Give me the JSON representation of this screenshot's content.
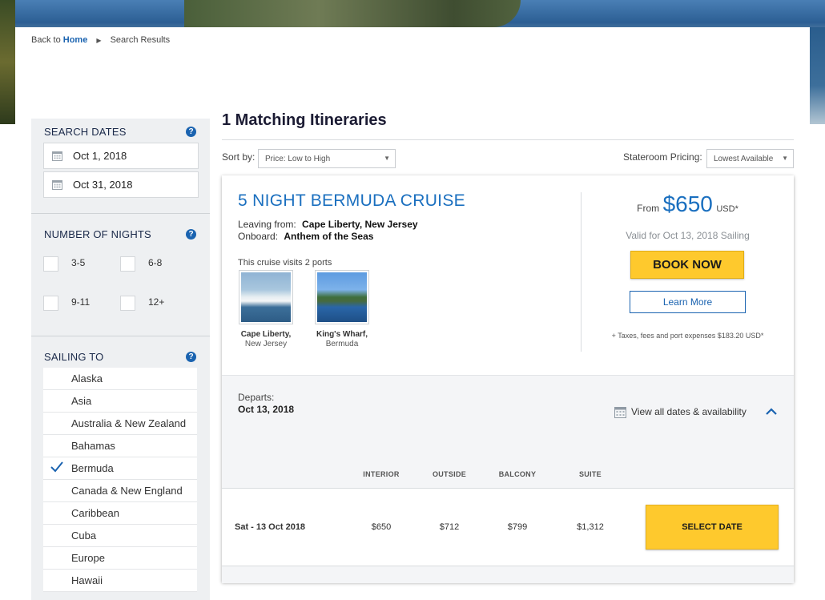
{
  "breadcrumb": {
    "back_prefix": "Back to",
    "home": "Home",
    "current": "Search Results"
  },
  "sidebar": {
    "search_dates": {
      "title": "SEARCH DATES",
      "start": "Oct 1, 2018",
      "end": "Oct 31, 2018"
    },
    "nights": {
      "title": "NUMBER OF NIGHTS",
      "options": [
        "3-5",
        "6-8",
        "9-11",
        "12+"
      ]
    },
    "sailing_to": {
      "title": "SAILING TO",
      "items": [
        "Alaska",
        "Asia",
        "Australia & New Zealand",
        "Bahamas",
        "Bermuda",
        "Canada & New England",
        "Caribbean",
        "Cuba",
        "Europe",
        "Hawaii"
      ],
      "selected": "Bermuda"
    }
  },
  "main": {
    "title": "1 Matching Itineraries",
    "sort_label": "Sort by:",
    "sort_value": "Price: Low to High",
    "pricing_label": "Stateroom Pricing:",
    "pricing_value": "Lowest Available"
  },
  "cruise": {
    "title": "5 NIGHT BERMUDA CRUISE",
    "leaving_label": "Leaving from:",
    "leaving_value": "Cape Liberty, New Jersey",
    "onboard_label": "Onboard:",
    "onboard_value": "Anthem of the Seas",
    "visits": "This cruise visits 2 ports",
    "ports": [
      {
        "name": "Cape Liberty,",
        "region": "New Jersey"
      },
      {
        "name": "King's Wharf,",
        "region": "Bermuda"
      }
    ],
    "from_label": "From",
    "price": "$650",
    "currency": "USD*",
    "valid": "Valid for Oct 13, 2018 Sailing",
    "book_label": "BOOK NOW",
    "learn_label": "Learn More",
    "taxes": "+ Taxes, fees and port expenses $183.20 USD*",
    "departs_label": "Departs:",
    "departs_value": "Oct 13, 2018",
    "view_all": "View all dates & availability",
    "columns": [
      "INTERIOR",
      "OUTSIDE",
      "BALCONY",
      "SUITE"
    ],
    "row": {
      "date": "Sat - 13 Oct 2018",
      "prices": [
        "$650",
        "$712",
        "$799",
        "$1,312"
      ],
      "action": "SELECT DATE"
    }
  },
  "colors": {
    "accent_blue": "#1a63b0",
    "title_blue": "#1a6fbf",
    "cta_yellow": "#fec92d"
  }
}
